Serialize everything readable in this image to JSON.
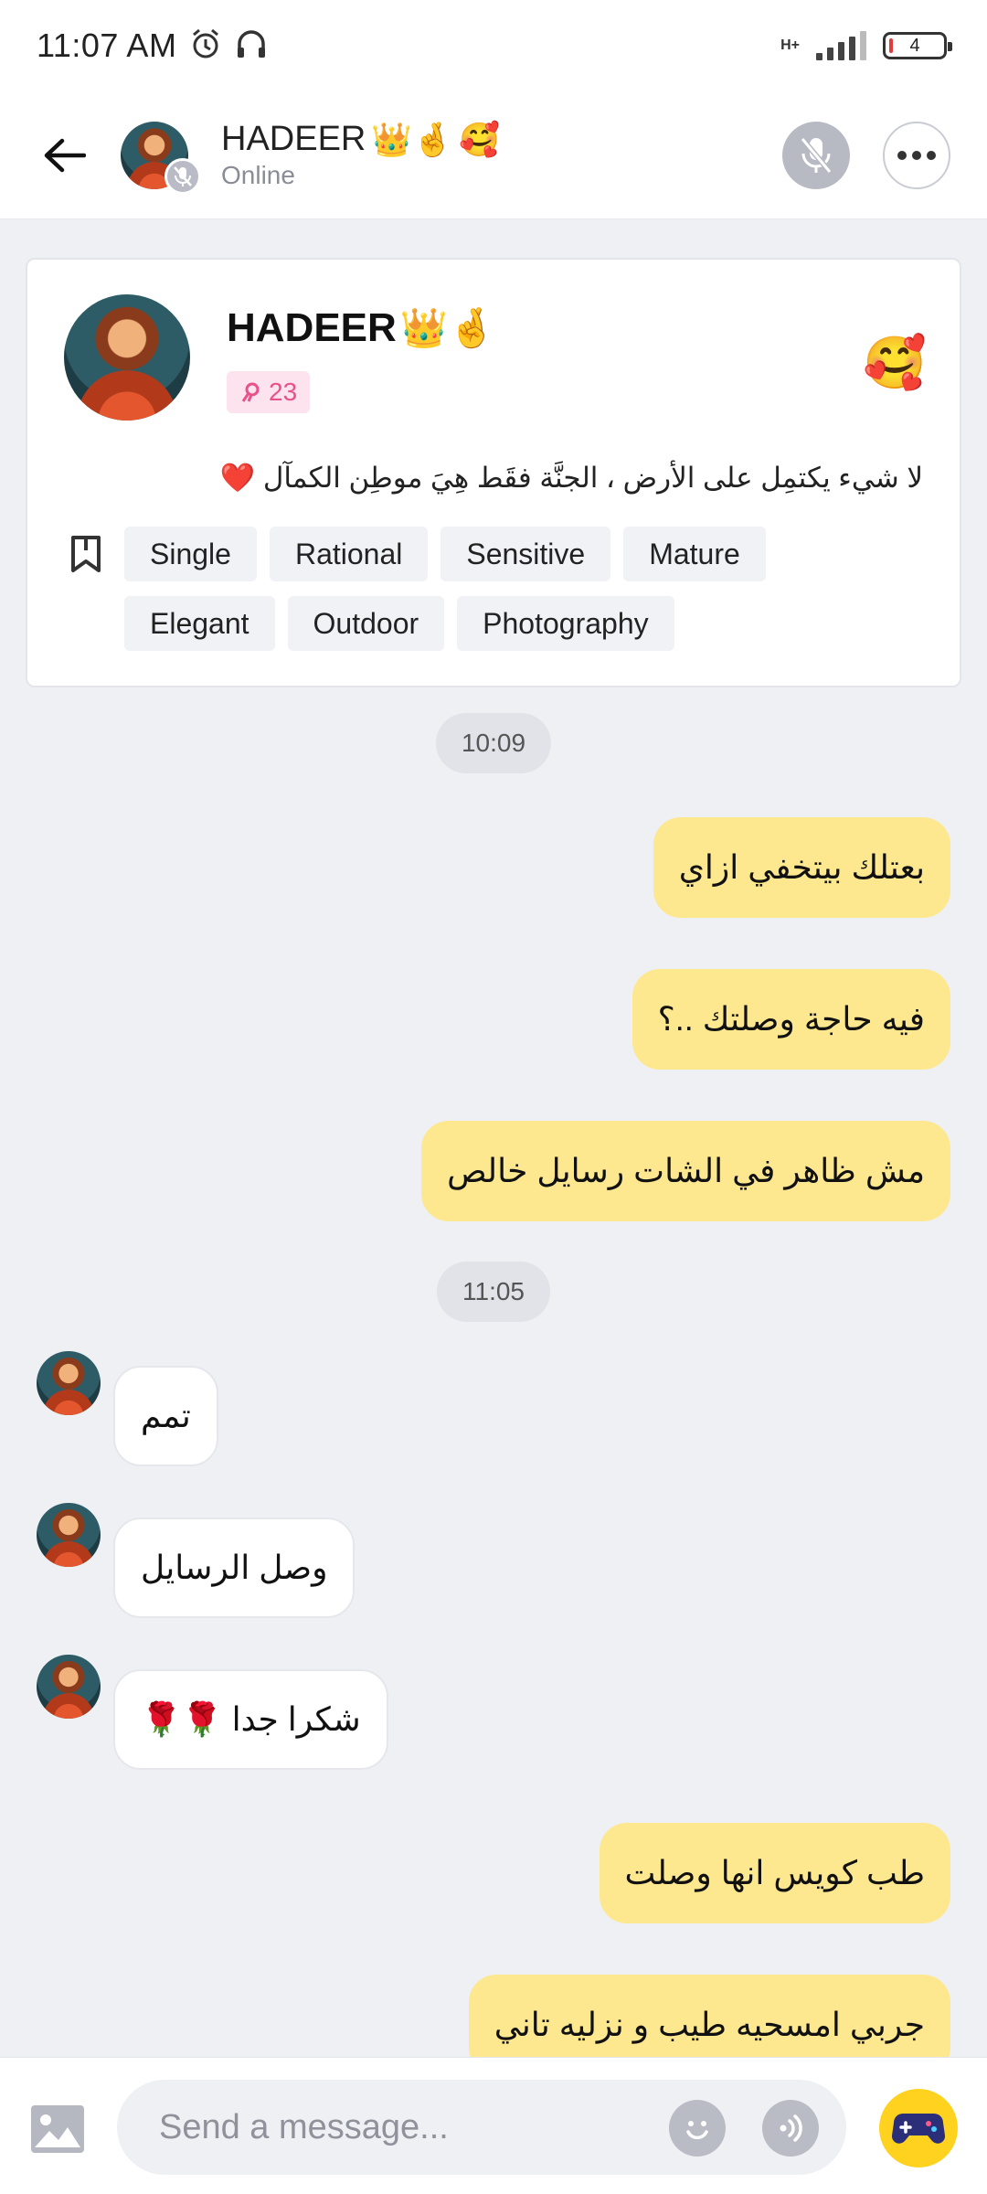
{
  "status_bar": {
    "time": "11:07 AM",
    "network_type": "H+",
    "battery_level": "4",
    "icons": [
      "alarm-icon",
      "headphones-icon",
      "signal-icon",
      "battery-icon"
    ]
  },
  "header": {
    "name": "HADEER",
    "name_emoji": "👑🤞",
    "sticker_emoji": "🥰",
    "status": "Online",
    "icons": [
      "back-arrow-icon",
      "muted-mic-icon",
      "more-icon"
    ]
  },
  "profile": {
    "name": "HADEER",
    "name_emoji": "👑🤞",
    "level": "23",
    "sticker_emoji": "🥰",
    "bio": "لا شيء يكتمِل على الأرض ، الجنَّة فقَط هِيَ موطِن الكمآل ❤️",
    "tags": [
      "Single",
      "Rational",
      "Sensitive",
      "Mature",
      "Elegant",
      "Outdoor",
      "Photography"
    ]
  },
  "chat": {
    "timestamps": [
      "10:09",
      "11:05"
    ],
    "outgoing": [
      "بعتلك بيتخفي ازاي",
      "فيه حاجة وصلتك ..؟",
      "مش ظاهر في الشات رسايل خالص",
      "طب كويس انها وصلت",
      "جربي امسحيه طيب و نزليه تاني"
    ],
    "incoming": [
      "تمم",
      "وصل الرسايل",
      "شكرا جدا 🌹🌹"
    ]
  },
  "input": {
    "placeholder": "Send a message..."
  },
  "colors": {
    "outgoing_bubble": "#fde88f",
    "incoming_bubble": "#ffffff",
    "background": "#eef0f4",
    "level_badge": "#fde3ee",
    "game_button": "#ffd21f"
  }
}
